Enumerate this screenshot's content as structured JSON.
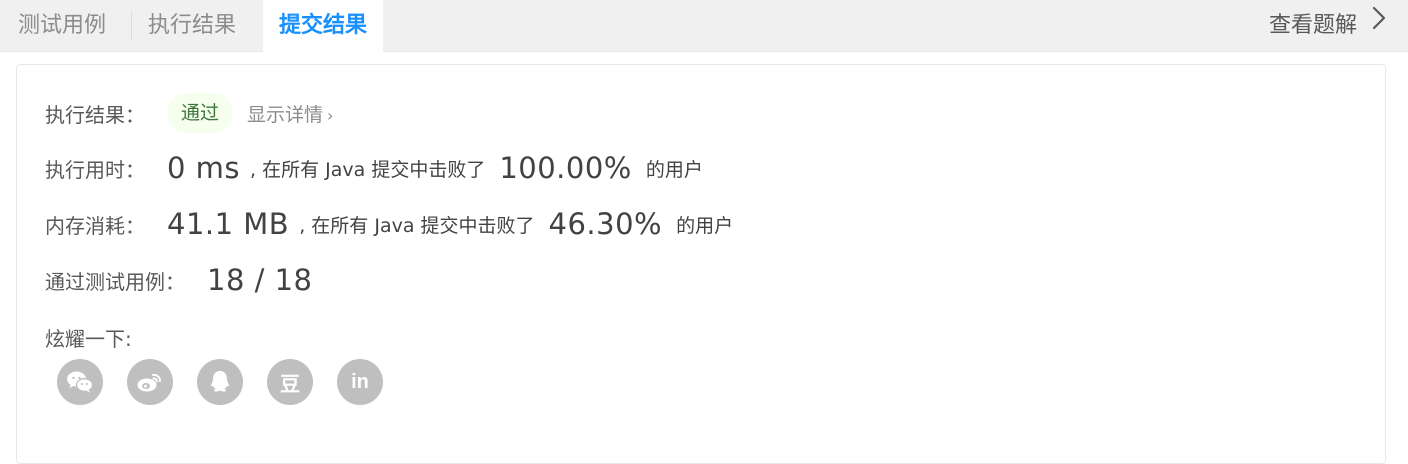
{
  "tabs": [
    {
      "label": "测试用例"
    },
    {
      "label": "执行结果"
    },
    {
      "label": "提交结果",
      "active": true
    }
  ],
  "solution_link": "查看题解",
  "result": {
    "label": "执行结果：",
    "status": "通过",
    "details": "显示详情",
    "details_arrow": "›"
  },
  "runtime": {
    "label": "执行用时：",
    "value": "0 ms",
    "text": ", 在所有 Java 提交中击败了",
    "percent": "100.00%",
    "suffix": "的用户"
  },
  "memory": {
    "label": "内存消耗：",
    "value": "41.1 MB",
    "text": ", 在所有 Java 提交中击败了",
    "percent": "46.30%",
    "suffix": "的用户"
  },
  "testcases": {
    "label": "通过测试用例：",
    "value": "18 / 18"
  },
  "share": {
    "label": "炫耀一下:",
    "icons": [
      "wechat-icon",
      "weibo-icon",
      "qq-icon",
      "douban-icon",
      "linkedin-icon"
    ],
    "douban_glyph": "豆",
    "linkedin_glyph": "in"
  },
  "colors": {
    "accent": "#1890ff",
    "success_bg": "#f6ffed",
    "success_text": "#3c763d",
    "icon_gray": "#bfbfbf"
  }
}
